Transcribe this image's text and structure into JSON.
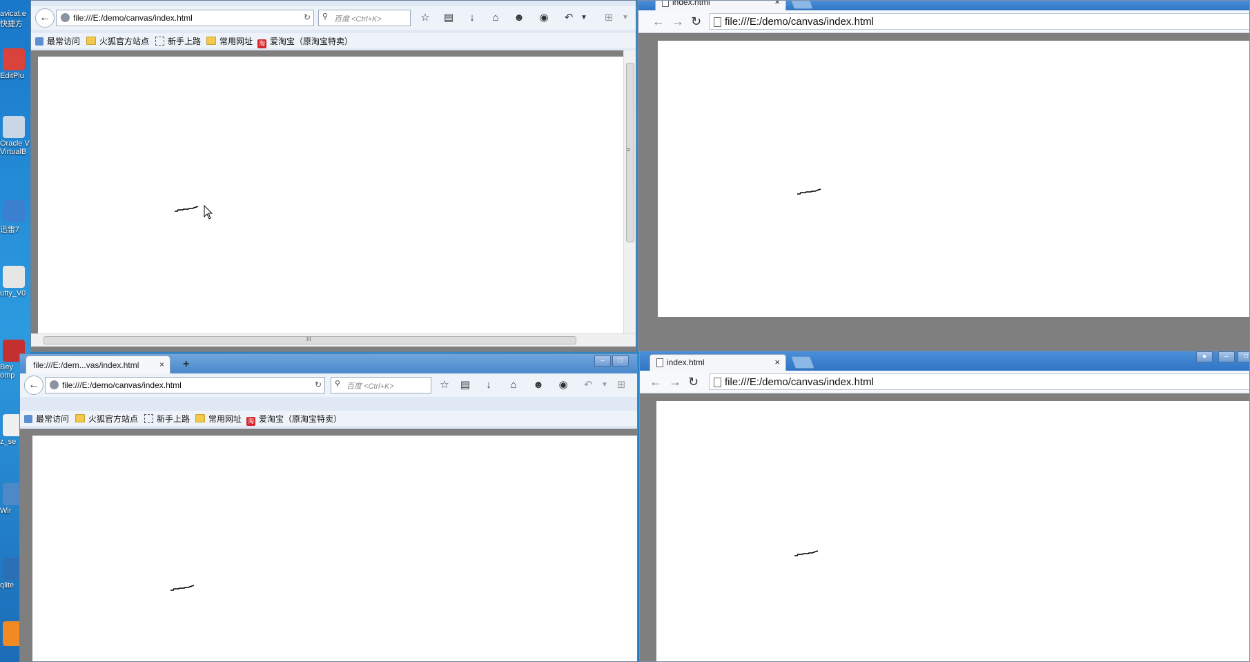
{
  "desktop": {
    "icons": [
      {
        "label": "avicat.e",
        "sub": "快捷方"
      },
      {
        "label": "EditPlu"
      },
      {
        "label": "Oracle V",
        "sub": "VirtualB"
      },
      {
        "label": "迅雷7"
      },
      {
        "label": "utty_V0"
      },
      {
        "label": "Bey",
        "sub": "omp"
      },
      {
        "label": "z_se"
      },
      {
        "label": "Wir"
      },
      {
        "label": "qlite"
      }
    ]
  },
  "firefox_top": {
    "url": "file:///E:/demo/canvas/index.html",
    "search_placeholder": "百度 <Ctrl+K>",
    "bookmarks": [
      "最常访问",
      "火狐官方站点",
      "新手上路",
      "常用网址",
      "爱淘宝（原淘宝特卖）"
    ],
    "taobao_icon_text": "淘",
    "scroll_grip": "≡",
    "hscroll_grip": "III"
  },
  "firefox_bottom": {
    "tab_title": "file:///E:/dem...vas/index.html",
    "tab_close": "×",
    "newtab": "+",
    "url": "file:///E:/demo/canvas/index.html",
    "search_placeholder": "百度 <Ctrl+K>",
    "bookmarks": [
      "最常访问",
      "火狐官方站点",
      "新手上路",
      "常用网址",
      "爱淘宝（原淘宝特卖）"
    ],
    "taobao_icon_text": "淘"
  },
  "chrome_top": {
    "tab_title": "index.html",
    "tab_close": "×",
    "url": "file:///E:/demo/canvas/index.html"
  },
  "chrome_bottom": {
    "tab_title": "index.html",
    "tab_close": "×",
    "url": "file:///E:/demo/canvas/index.html"
  },
  "toolbar_icons": [
    "back-icon",
    "reload-icon",
    "search-icon",
    "star-icon",
    "reading-list-icon",
    "download-icon",
    "home-icon",
    "smile-icon",
    "chat-icon",
    "undo-icon",
    "dropdown-icon",
    "crop-icon",
    "menu-icon"
  ],
  "colors": {
    "desktop": "#2b8fd6",
    "firefox_chrome": "#dfe8f4",
    "page_bg": "#7f7f7f",
    "canvas": "#ffffff",
    "stroke": "#000000"
  }
}
